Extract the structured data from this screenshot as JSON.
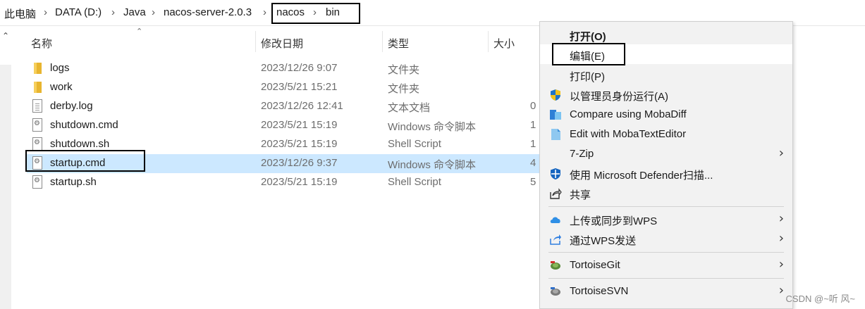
{
  "breadcrumb": {
    "items": [
      "此电脑",
      "DATA (D:)",
      "Java",
      "nacos-server-2.0.3",
      "nacos",
      "bin"
    ],
    "separator": "›"
  },
  "columns": {
    "name": "名称",
    "date": "修改日期",
    "type": "类型",
    "size": "大小"
  },
  "files": [
    {
      "name": "logs",
      "date": "2023/12/26 9:07",
      "type": "文件夹",
      "size": "",
      "icon": "folder-icon"
    },
    {
      "name": "work",
      "date": "2023/5/21 15:21",
      "type": "文件夹",
      "size": "",
      "icon": "folder-icon"
    },
    {
      "name": "derby.log",
      "date": "2023/12/26 12:41",
      "type": "文本文档",
      "size": "0",
      "icon": "text-file-icon"
    },
    {
      "name": "shutdown.cmd",
      "date": "2023/5/21 15:19",
      "type": "Windows 命令脚本",
      "size": "1",
      "icon": "script-file-icon"
    },
    {
      "name": "shutdown.sh",
      "date": "2023/5/21 15:19",
      "type": "Shell Script",
      "size": "1",
      "icon": "script-file-icon"
    },
    {
      "name": "startup.cmd",
      "date": "2023/12/26 9:37",
      "type": "Windows 命令脚本",
      "size": "4",
      "icon": "script-file-icon",
      "selected": true
    },
    {
      "name": "startup.sh",
      "date": "2023/5/21 15:19",
      "type": "Shell Script",
      "size": "5",
      "icon": "script-file-icon"
    }
  ],
  "context_menu": {
    "open": "打开(O)",
    "edit": "编辑(E)",
    "print": "打印(P)",
    "run_as_admin": "以管理员身份运行(A)",
    "compare_mobadiff": "Compare using MobaDiff",
    "edit_mobatext": "Edit with MobaTextEditor",
    "zip": "7-Zip",
    "defender": "使用 Microsoft Defender扫描...",
    "share": "共享",
    "wps_upload": "上传或同步到WPS",
    "wps_send": "通过WPS发送",
    "tortoisegit": "TortoiseGit",
    "tortoisesvn": "TortoiseSVN",
    "submenu_arrow": "›"
  },
  "watermark": "CSDN @~听 风~",
  "colors": {
    "selection": "#cce8ff",
    "menu_bg": "#f2f2f2",
    "menu_hover": "#ffffff",
    "highlight_border": "#000000"
  }
}
